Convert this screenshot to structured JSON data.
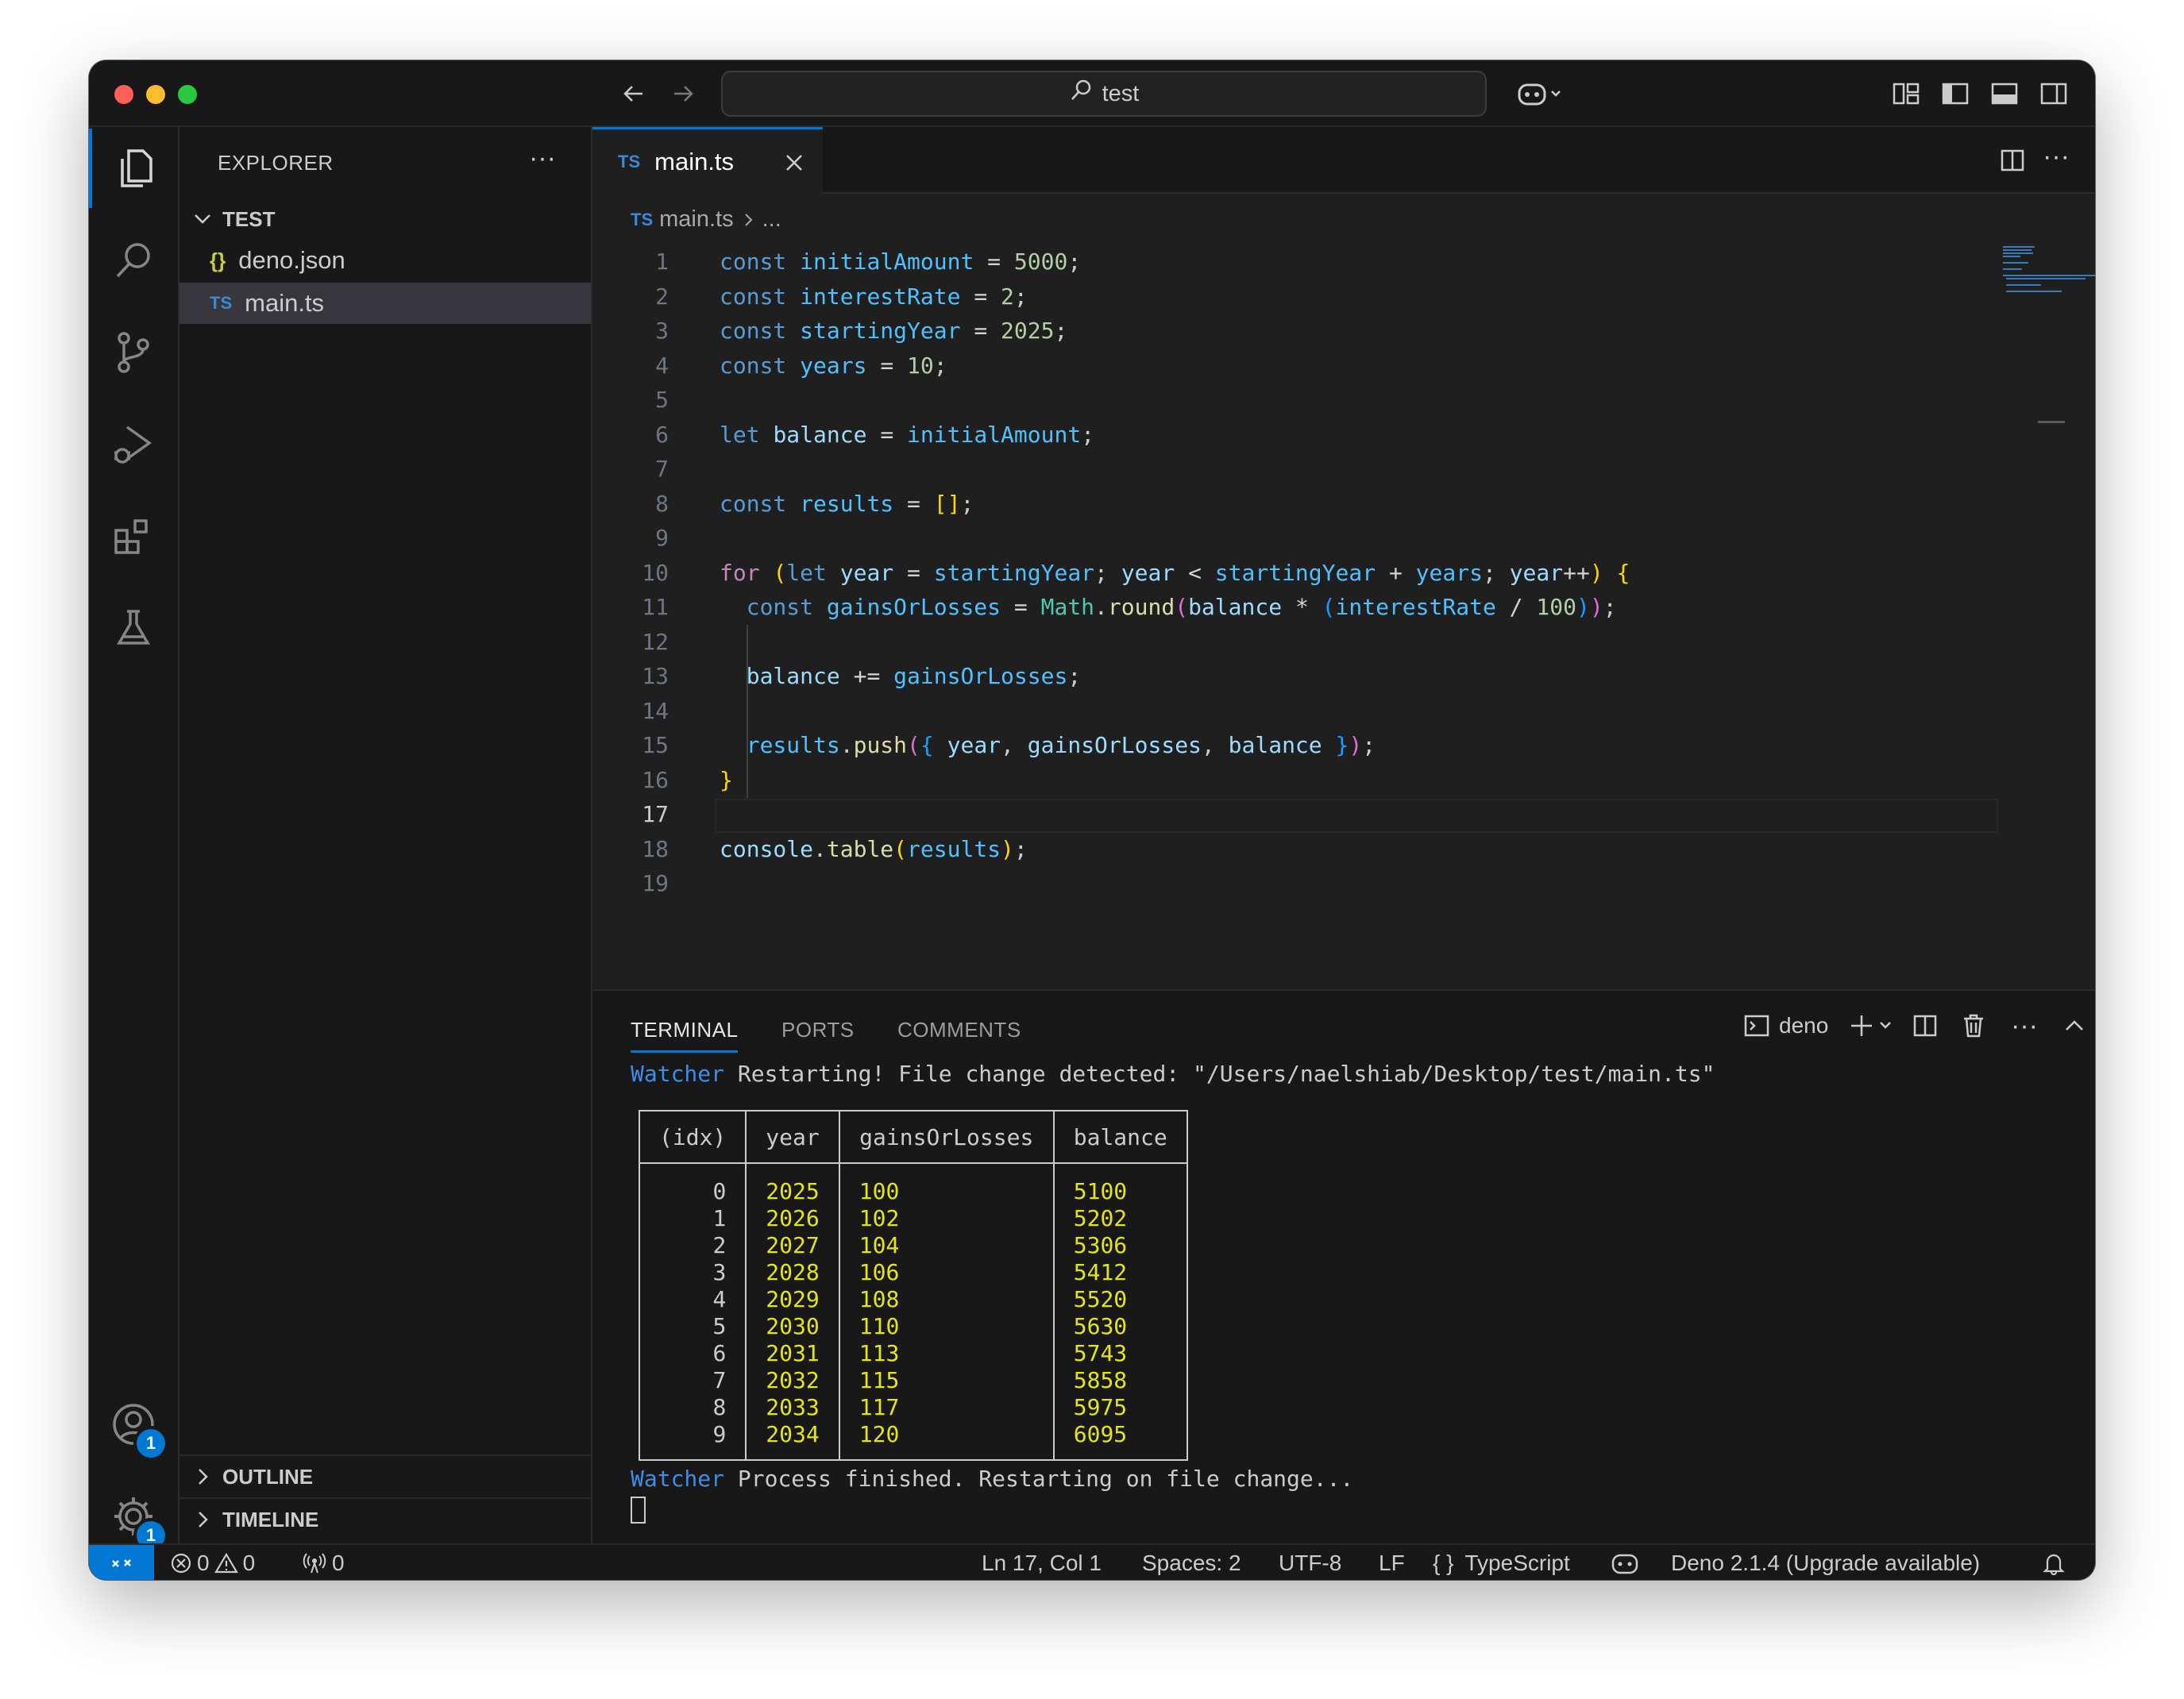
{
  "titlebar": {
    "search_text": "test"
  },
  "sidebar": {
    "title": "EXPLORER",
    "folder": "TEST",
    "files": [
      {
        "icon": "{}",
        "name": "deno.json"
      },
      {
        "icon": "TS",
        "name": "main.ts"
      }
    ],
    "sections": [
      "OUTLINE",
      "TIMELINE"
    ]
  },
  "activity": {
    "accounts_badge": "1",
    "settings_badge": "1"
  },
  "editor": {
    "tab": {
      "icon": "TS",
      "label": "main.ts"
    },
    "breadcrumb": {
      "icon": "TS",
      "file": "main.ts",
      "rest": "..."
    },
    "line_numbers": [
      "1",
      "2",
      "3",
      "4",
      "5",
      "6",
      "7",
      "8",
      "9",
      "10",
      "11",
      "12",
      "13",
      "14",
      "15",
      "16",
      "17",
      "18",
      "19"
    ],
    "current_line": 17
  },
  "panel": {
    "tabs": [
      "TERMINAL",
      "PORTS",
      "COMMENTS"
    ],
    "terminal_name": "deno",
    "watcher_label": "Watcher",
    "line1": " Restarting! File change detected: \"/Users/naelshiab/Desktop/test/main.ts\"",
    "line2": " Process finished. Restarting on file change...",
    "table": {
      "headers": [
        "(idx)",
        "year",
        "gainsOrLosses",
        "balance"
      ],
      "rows": [
        [
          "0",
          "2025",
          "100",
          "5100"
        ],
        [
          "1",
          "2026",
          "102",
          "5202"
        ],
        [
          "2",
          "2027",
          "104",
          "5306"
        ],
        [
          "3",
          "2028",
          "106",
          "5412"
        ],
        [
          "4",
          "2029",
          "108",
          "5520"
        ],
        [
          "5",
          "2030",
          "110",
          "5630"
        ],
        [
          "6",
          "2031",
          "113",
          "5743"
        ],
        [
          "7",
          "2032",
          "115",
          "5858"
        ],
        [
          "8",
          "2033",
          "117",
          "5975"
        ],
        [
          "9",
          "2034",
          "120",
          "6095"
        ]
      ]
    }
  },
  "statusbar": {
    "errors": "0",
    "warnings": "0",
    "ports": "0",
    "position": "Ln 17, Col 1",
    "spaces": "Spaces: 2",
    "encoding": "UTF-8",
    "eol": "LF",
    "language": "TypeScript",
    "deno": "Deno 2.1.4 (Upgrade available)"
  }
}
